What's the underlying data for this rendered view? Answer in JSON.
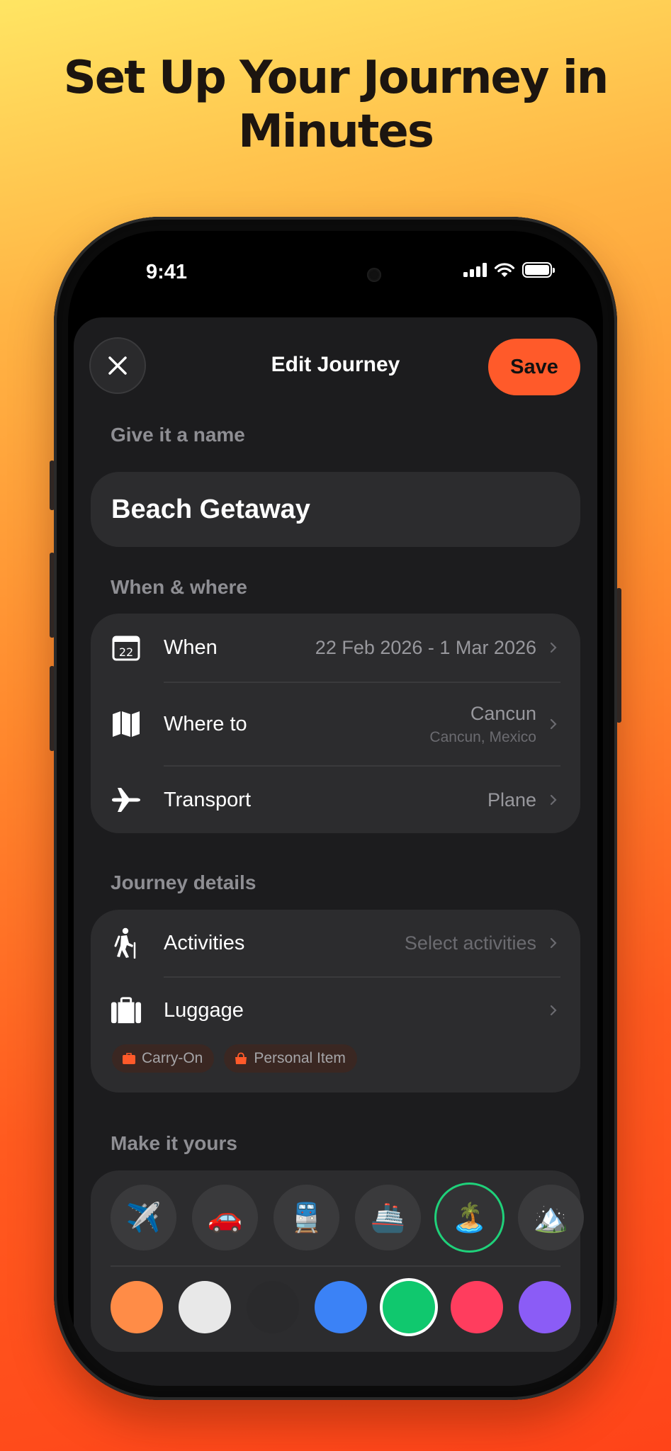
{
  "headline": "Set Up Your Journey in Minutes",
  "status": {
    "time": "9:41"
  },
  "nav": {
    "title": "Edit Journey",
    "save_label": "Save"
  },
  "name_section": {
    "label": "Give it a name",
    "value": "Beach Getaway"
  },
  "when_where": {
    "label": "When & where",
    "rows": [
      {
        "icon": "calendar-icon",
        "icon_text": "22",
        "label": "When",
        "value": "22 Feb 2026 - 1 Mar 2026"
      },
      {
        "icon": "map-icon",
        "label": "Where to",
        "value": "Cancun",
        "sub": "Cancun, Mexico"
      },
      {
        "icon": "airplane-icon",
        "label": "Transport",
        "value": "Plane"
      }
    ]
  },
  "details": {
    "label": "Journey details",
    "rows": [
      {
        "icon": "hiker-icon",
        "label": "Activities",
        "value": "Select activities"
      },
      {
        "icon": "suitcase-icon",
        "label": "Luggage",
        "value": ""
      }
    ],
    "chips": [
      {
        "icon": "suitcase-icon",
        "label": "Carry-On"
      },
      {
        "icon": "bag-icon",
        "label": "Personal Item"
      }
    ]
  },
  "customize": {
    "label": "Make it yours",
    "emojis": [
      {
        "name": "airplane",
        "glyph": "✈️"
      },
      {
        "name": "car",
        "glyph": "🚗"
      },
      {
        "name": "train",
        "glyph": "🚆"
      },
      {
        "name": "ship",
        "glyph": "🚢"
      },
      {
        "name": "beach",
        "glyph": "🏝️"
      },
      {
        "name": "mountain",
        "glyph": "🏔️"
      }
    ],
    "selected_emoji": 4,
    "colors": [
      "#ff8c47",
      "#e8e8e8",
      "#2a2a2c",
      "#3b82f6",
      "#10c86e",
      "#ff3d5e",
      "#8b5cf6"
    ],
    "selected_color": 4
  },
  "theme": {
    "accent": "#ff5a2a",
    "selected_ring": "#1fd17a"
  }
}
